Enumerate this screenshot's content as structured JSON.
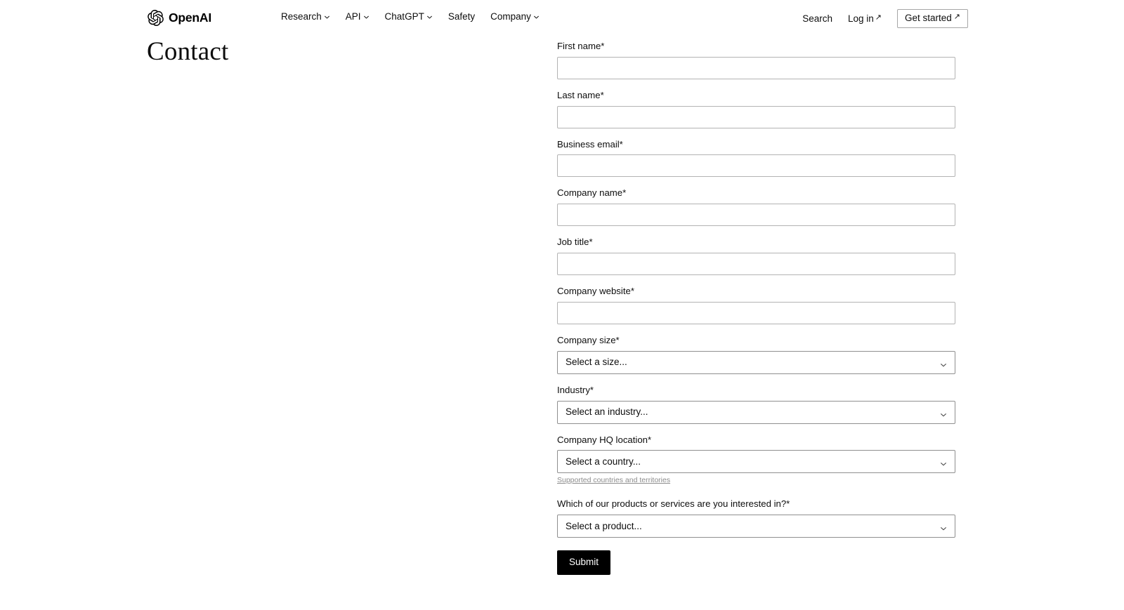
{
  "header": {
    "brand_name": "OpenAI",
    "brand_icon": "openai-blossom-logo",
    "nav": [
      {
        "label": "Research",
        "has_chevron": true
      },
      {
        "label": "API",
        "has_chevron": true
      },
      {
        "label": "ChatGPT",
        "has_chevron": true
      },
      {
        "label": "Safety",
        "has_chevron": false
      },
      {
        "label": "Company",
        "has_chevron": true
      }
    ],
    "search_label": "Search",
    "login_label": "Log in",
    "login_arrow": "↗",
    "get_started_label": "Get started",
    "get_started_arrow": "↗"
  },
  "page": {
    "title": "Contact"
  },
  "form": {
    "fields": [
      {
        "label": "First name*",
        "type": "text",
        "value": "",
        "placeholder": ""
      },
      {
        "label": "Last name*",
        "type": "text",
        "value": "",
        "placeholder": ""
      },
      {
        "label": "Business email*",
        "type": "text",
        "value": "",
        "placeholder": ""
      },
      {
        "label": "Company name*",
        "type": "text",
        "value": "",
        "placeholder": ""
      },
      {
        "label": "Job title*",
        "type": "text",
        "value": "",
        "placeholder": ""
      },
      {
        "label": "Company website*",
        "type": "text",
        "value": "",
        "placeholder": ""
      }
    ],
    "company_size": {
      "label": "Company size*",
      "selected": "Select a size..."
    },
    "industry": {
      "label": "Industry*",
      "selected": "Select an industry..."
    },
    "hq_location": {
      "label": "Company HQ location*",
      "selected": "Select a country...",
      "helper_link": "Supported countries and territories"
    },
    "product_interest": {
      "label": "Which of our products or services are you interested in?*",
      "selected": "Select a product..."
    },
    "submit_label": "Submit"
  },
  "colors": {
    "accent": "#000000",
    "text": "#0d0d0d",
    "border": "#b3b3b3",
    "select_border": "#8f8f8f",
    "muted": "#8c8c8c",
    "background": "#ffffff"
  }
}
